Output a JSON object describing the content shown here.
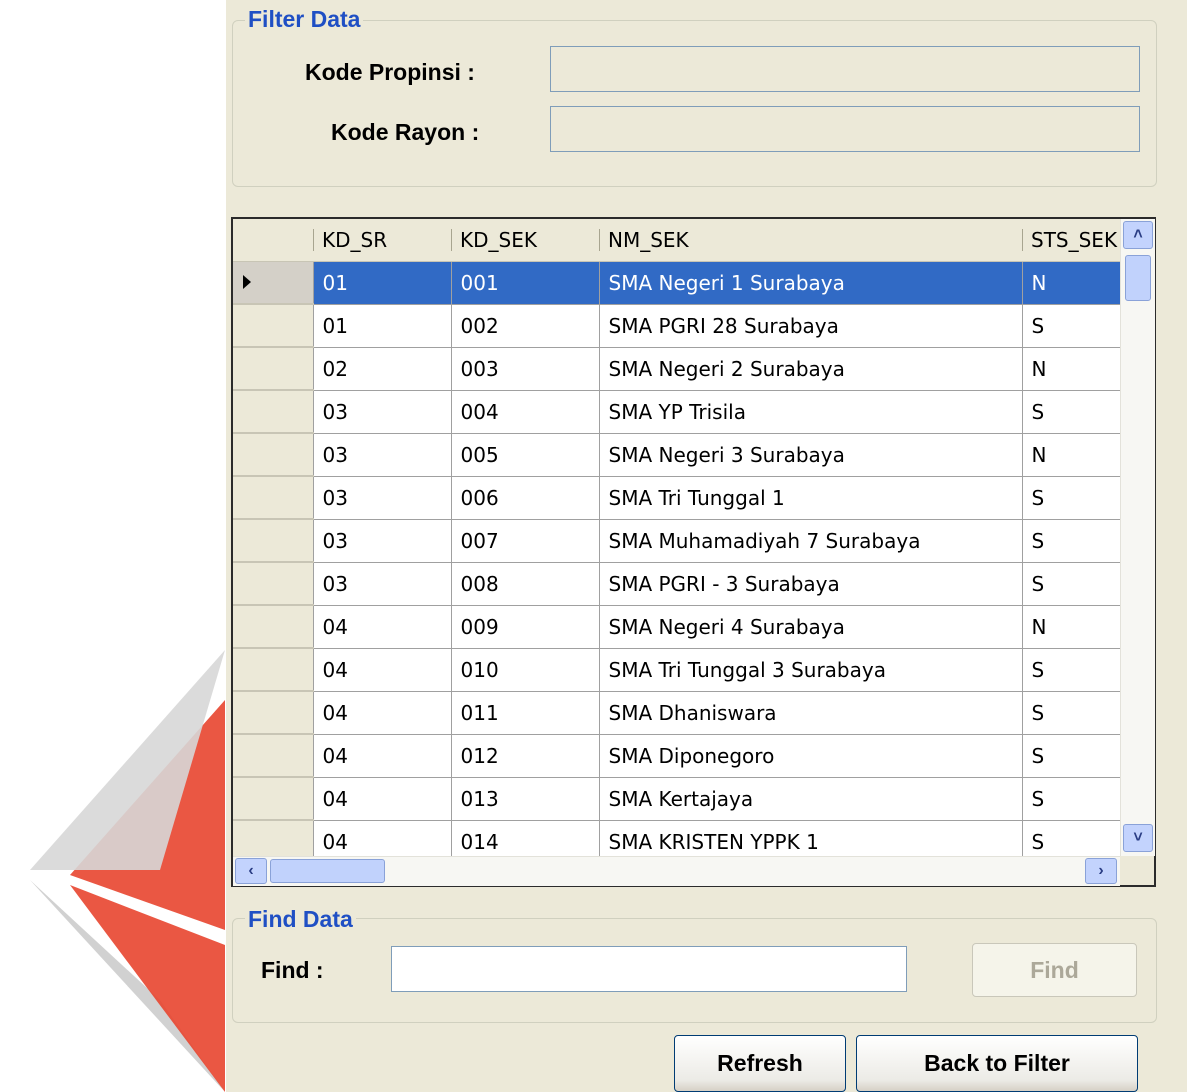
{
  "filter": {
    "title": "Filter Data",
    "kode_propinsi_label": "Kode Propinsi :",
    "kode_propinsi_value": "",
    "kode_rayon_label": "Kode Rayon :",
    "kode_rayon_value": ""
  },
  "grid": {
    "columns": [
      "KD_SR",
      "KD_SEK",
      "NM_SEK",
      "STS_SEK"
    ],
    "selected_row": 0,
    "rows": [
      [
        "01",
        "001",
        "SMA Negeri 1 Surabaya",
        "N"
      ],
      [
        "01",
        "002",
        "SMA PGRI 28 Surabaya",
        "S"
      ],
      [
        "02",
        "003",
        "SMA Negeri 2 Surabaya",
        "N"
      ],
      [
        "03",
        "004",
        "SMA YP Trisila",
        "S"
      ],
      [
        "03",
        "005",
        "SMA Negeri 3 Surabaya",
        "N"
      ],
      [
        "03",
        "006",
        "SMA Tri Tunggal 1",
        "S"
      ],
      [
        "03",
        "007",
        "SMA Muhamadiyah 7 Surabaya",
        "S"
      ],
      [
        "03",
        "008",
        "SMA PGRI - 3 Surabaya",
        "S"
      ],
      [
        "04",
        "009",
        "SMA Negeri 4 Surabaya",
        "N"
      ],
      [
        "04",
        "010",
        "SMA Tri Tunggal 3 Surabaya",
        "S"
      ],
      [
        "04",
        "011",
        "SMA Dhaniswara",
        "S"
      ],
      [
        "04",
        "012",
        "SMA Diponegoro",
        "S"
      ],
      [
        "04",
        "013",
        "SMA Kertajaya",
        "S"
      ],
      [
        "04",
        "014",
        "SMA KRISTEN YPPK 1",
        "S"
      ]
    ]
  },
  "find": {
    "title": "Find Data",
    "label": "Find :",
    "value": "",
    "button": "Find"
  },
  "buttons": {
    "refresh": "Refresh",
    "back": "Back to Filter"
  },
  "colors": {
    "group_title": "#1f4fc4",
    "selection": "#316ac5",
    "panel": "#ece9d8"
  }
}
